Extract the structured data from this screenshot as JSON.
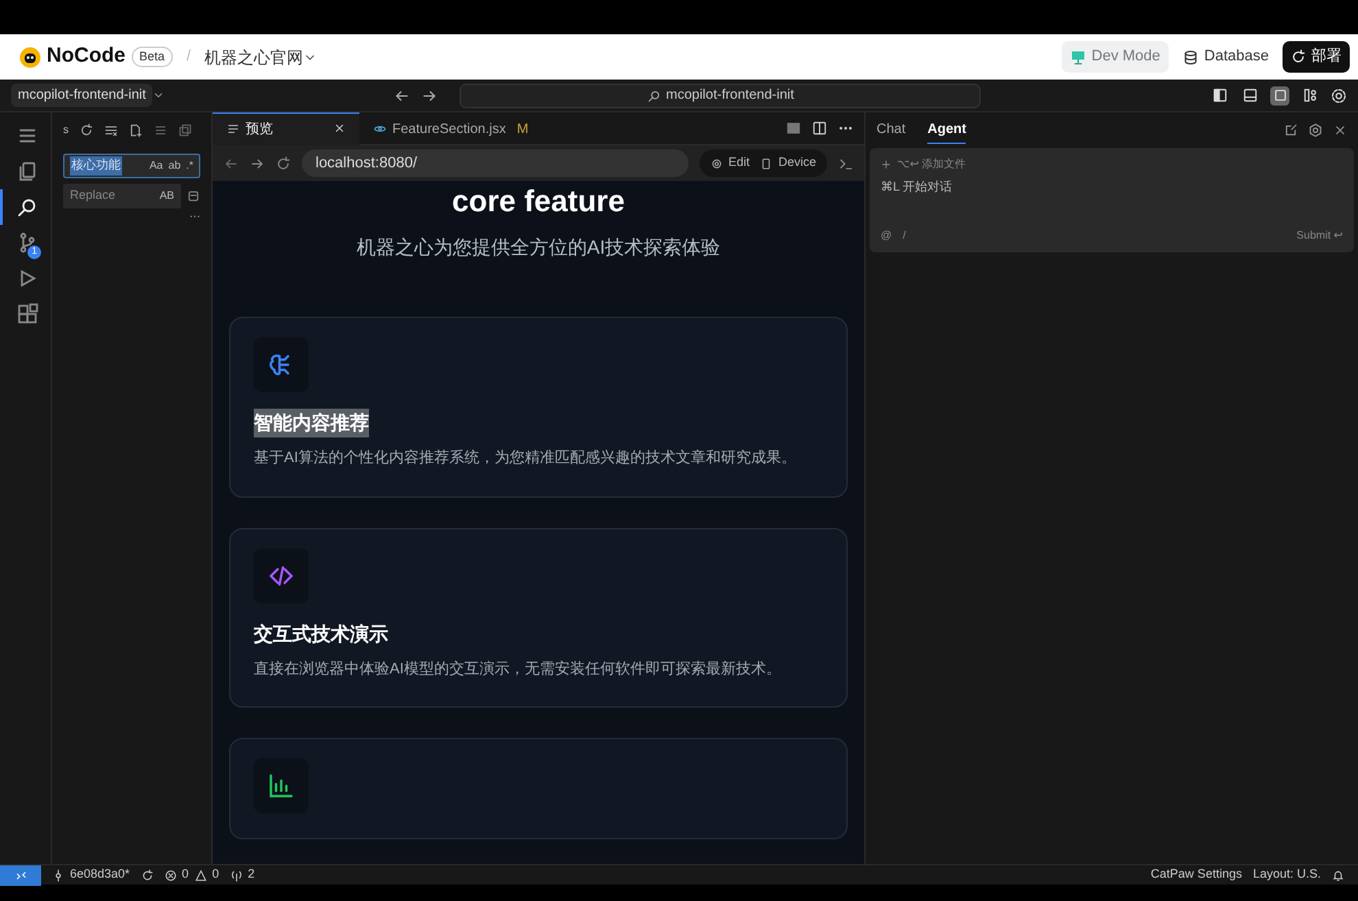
{
  "header": {
    "brand": "NoCode",
    "badge": "Beta",
    "separator": "/",
    "project": "机器之心官网",
    "actions": [
      {
        "label": "Dev Mode",
        "kind": "mode",
        "selected": true
      },
      {
        "label": "Database",
        "kind": "db",
        "selected": false
      },
      {
        "label": "部署",
        "kind": "deploy",
        "selected": false
      }
    ]
  },
  "titlebar": {
    "workspace": "mcopilot-frontend-init",
    "search": "mcopilot-frontend-init",
    "layout_toggles": [
      {
        "kind": "left",
        "on": false
      },
      {
        "kind": "bottom",
        "on": false
      },
      {
        "kind": "chat",
        "on": true
      },
      {
        "kind": "grid",
        "on": false
      }
    ]
  },
  "activity_bar": [
    {
      "kind": "menu",
      "selected": false
    },
    {
      "kind": "files",
      "selected": false
    },
    {
      "kind": "search",
      "selected": true
    },
    {
      "kind": "git",
      "selected": false,
      "badge": "1"
    },
    {
      "kind": "run",
      "selected": false
    },
    {
      "kind": "extensions",
      "selected": false
    }
  ],
  "search_panel": {
    "find_value": "核心功能",
    "find_toggles": [
      "Aa",
      "ab",
      ".*"
    ],
    "replace_placeholder": "Replace",
    "replace_toggle": "AB",
    "more": "···",
    "toolbar_letter": "s"
  },
  "editor": {
    "tabs": [
      {
        "label": "预览",
        "kind": "preview",
        "selected": true
      },
      {
        "label": "FeatureSection.jsx",
        "kind": "file",
        "selected": false,
        "modified": "M"
      }
    ],
    "address": "localhost:8080/",
    "edit_label": "Edit",
    "device_label": "Device"
  },
  "preview": {
    "heading": "core feature",
    "subtitle": "机器之心为您提供全方位的AI技术探索体验",
    "cards": [
      {
        "kind": "brain",
        "title": "智能内容推荐",
        "highlighted": true,
        "description": "基于AI算法的个性化内容推荐系统，为您精准匹配感兴趣的技术文章和研究成果。"
      },
      {
        "kind": "code",
        "title": "交互式技术演示",
        "highlighted": false,
        "description": "直接在浏览器中体验AI模型的交互演示，无需安装任何软件即可探索最新技术。"
      },
      {
        "kind": "chart"
      }
    ]
  },
  "chat_panel": {
    "tabs": [
      {
        "label": "Chat",
        "selected": false
      },
      {
        "label": "Agent",
        "selected": true
      }
    ],
    "attach_hint": "⌥↩ 添加文件",
    "placeholder": "⌘L 开始对话",
    "mention": "@",
    "slash": "/",
    "submit": "Submit ↩"
  },
  "status_bar": {
    "branch": "6e08d3a0*",
    "errors": "0",
    "warnings": "0",
    "ports": "2",
    "settings": "CatPaw Settings",
    "layout": "Layout: U.S."
  }
}
